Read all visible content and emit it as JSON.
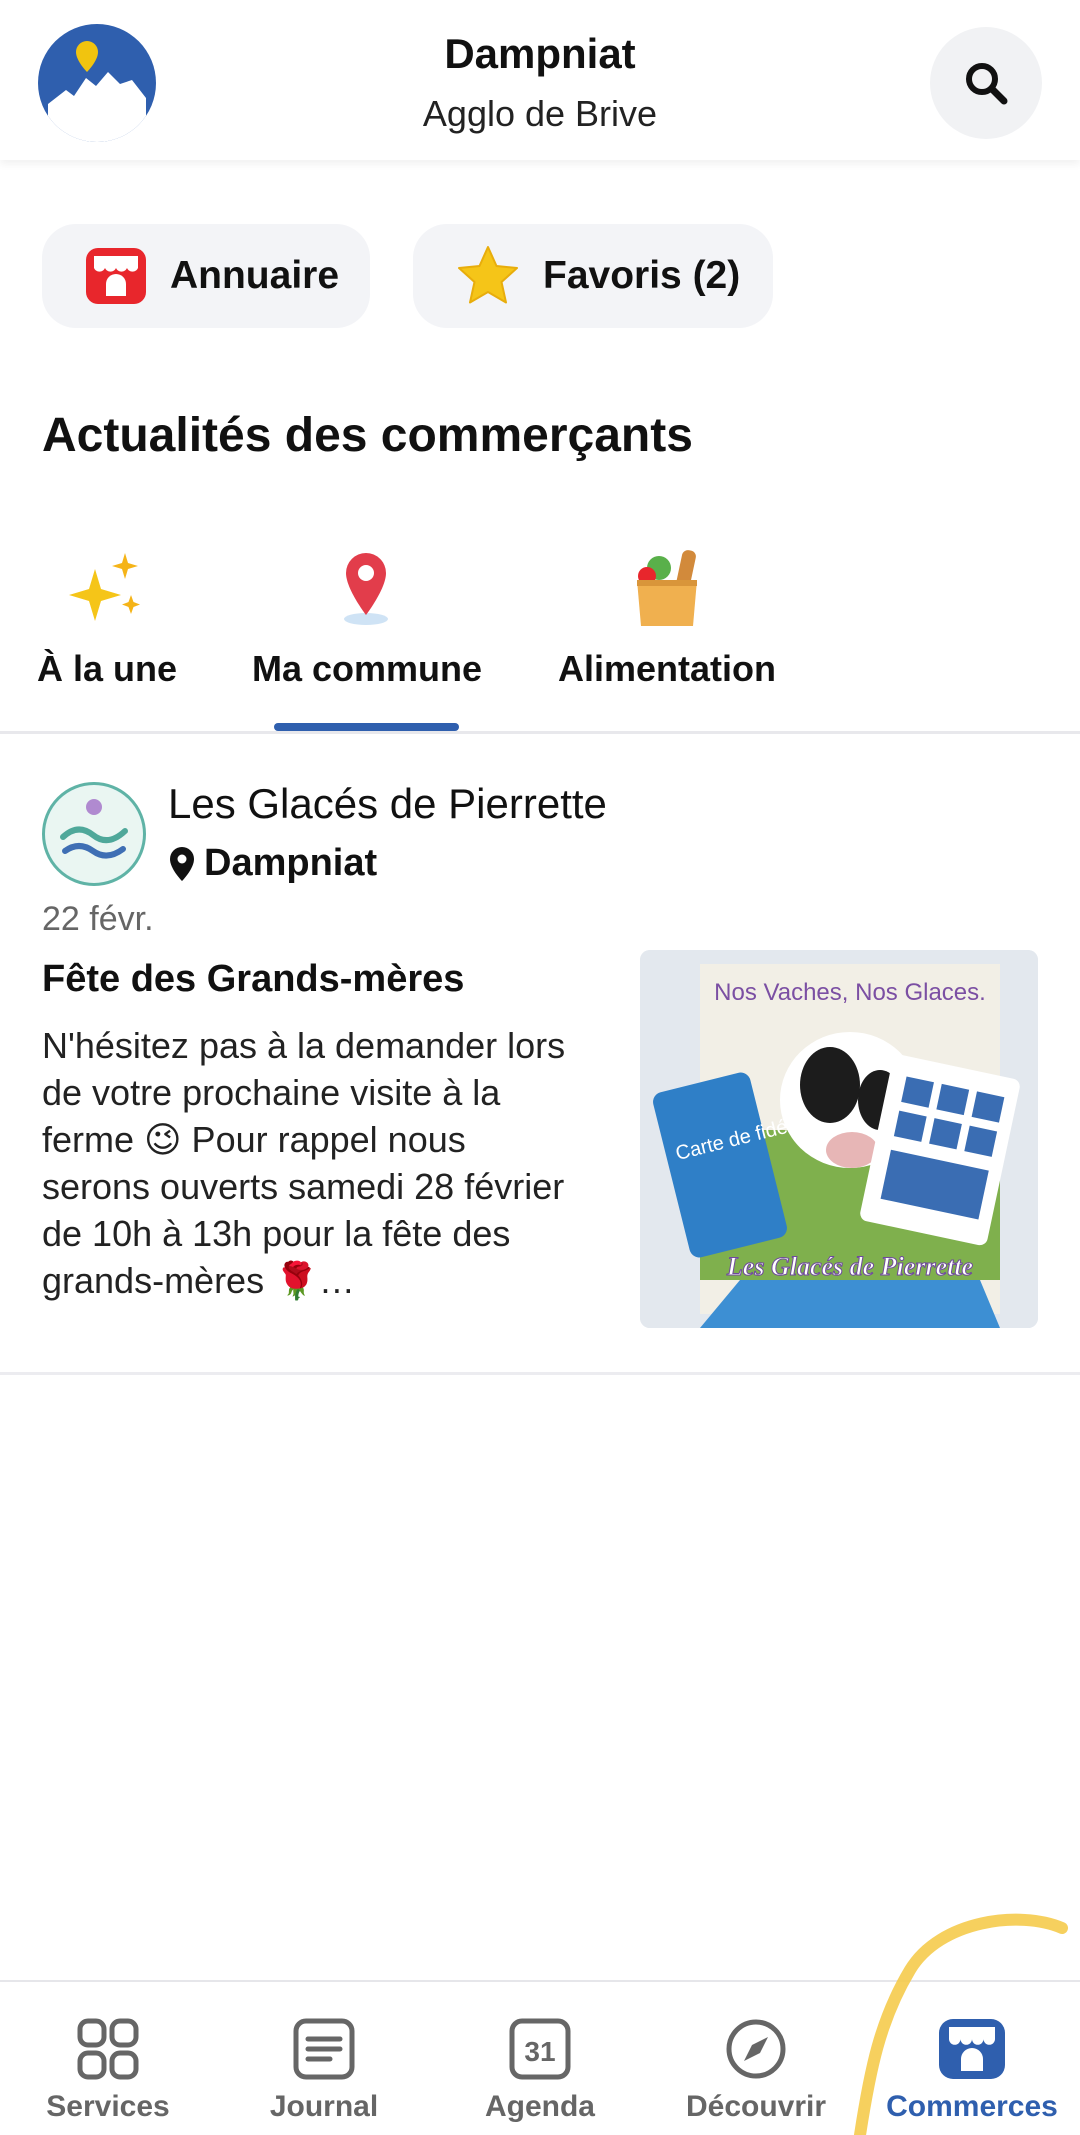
{
  "header": {
    "title": "Dampniat",
    "subtitle": "Agglo de Brive"
  },
  "chips": {
    "annuaire_label": "Annuaire",
    "favoris_label": "Favoris (2)"
  },
  "section": {
    "title": "Actualités des commerçants"
  },
  "tabs": [
    {
      "label": "À la une",
      "icon": "sparkles-icon"
    },
    {
      "label": "Ma commune",
      "icon": "map-pin-icon",
      "selected": true
    },
    {
      "label": "Alimentation",
      "icon": "grocery-bag-icon"
    }
  ],
  "post": {
    "merchant_name": "Les Glacés de Pierrette",
    "location": "Dampniat",
    "date": "22 févr.",
    "title": "Fête des Grands-mères",
    "body": "N'hésitez pas à la demander lors de votre prochaine visite à la ferme 😉 Pour rappel nous serons ouverts samedi 28 février de 10h à 13h pour la fête des grands-mères 🌹…",
    "image": {
      "banner_text": "Nos Vaches, Nos Glaces.",
      "card_text": "Carte de fidélité",
      "brand_text": "Les Glacés de Pierrette"
    }
  },
  "bottom_nav": [
    {
      "label": "Services",
      "icon": "grid-icon"
    },
    {
      "label": "Journal",
      "icon": "newspaper-icon"
    },
    {
      "label": "Agenda",
      "icon": "calendar-icon",
      "icon_text": "31"
    },
    {
      "label": "Découvrir",
      "icon": "compass-icon"
    },
    {
      "label": "Commerces",
      "icon": "storefront-icon",
      "active": true
    }
  ],
  "colors": {
    "accent": "#2f5fae",
    "chip_bg": "#f3f4f7",
    "annuaire_icon": "#e8262c",
    "favoris_star": "#f5c518",
    "pin": "#e23d4b",
    "highlight_stroke": "#f5c842"
  }
}
